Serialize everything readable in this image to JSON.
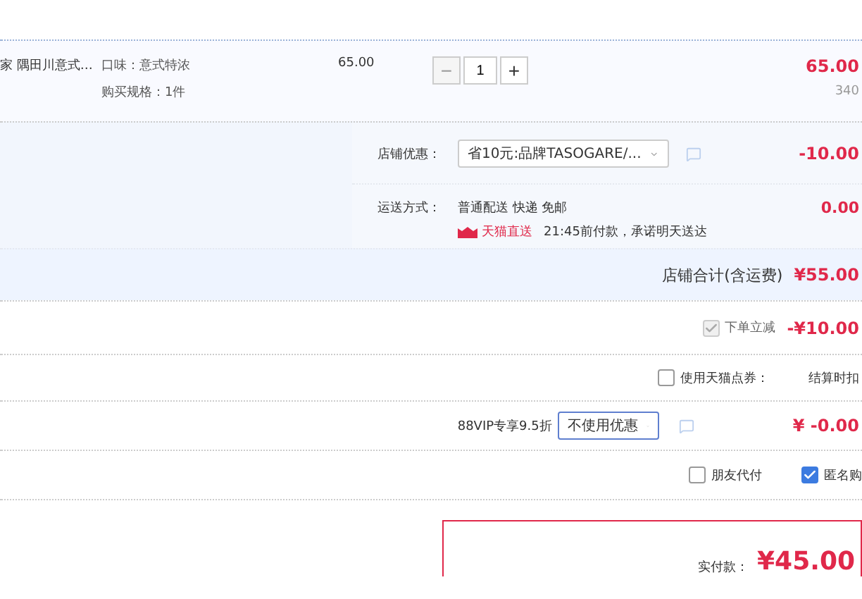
{
  "product": {
    "title": "家 隅田川意式…",
    "attributes": [
      "口味：意式特浓",
      "购买规格：1件"
    ],
    "unit_price": "65.00",
    "quantity": "1",
    "minus": "−",
    "plus": "+",
    "subtotal": "65.00",
    "weight": "340"
  },
  "shop": {
    "discount_label": "店铺优惠：",
    "discount_value": "省10元:品牌TASOGARE/...",
    "discount_amount": "-10.00",
    "shipping_label": "运送方式：",
    "shipping_method": "普通配送 快递 免邮",
    "badge": "天猫直送",
    "promise": "21:45前付款，承诺明天送达",
    "shipping_amount": "0.00",
    "total_label": "店铺合计(含运费)",
    "total": "¥55.00"
  },
  "options": [
    {
      "kind": "check",
      "label": "下单立减",
      "checked": true,
      "disabled": true,
      "amount": "-¥10.00"
    },
    {
      "kind": "check",
      "label": "使用天猫点券：",
      "checked": false,
      "disabled": false,
      "note": "结算时扣"
    },
    {
      "kind": "select",
      "label": "88VIP专享9.5折",
      "value": "不使用优惠",
      "amount": "¥ -0.00"
    }
  ],
  "extras": [
    {
      "label": "朋友代付",
      "checked": false
    },
    {
      "label": "匿名购",
      "checked": true
    }
  ],
  "payment": {
    "label": "实付款：",
    "amount": "¥45.00"
  }
}
